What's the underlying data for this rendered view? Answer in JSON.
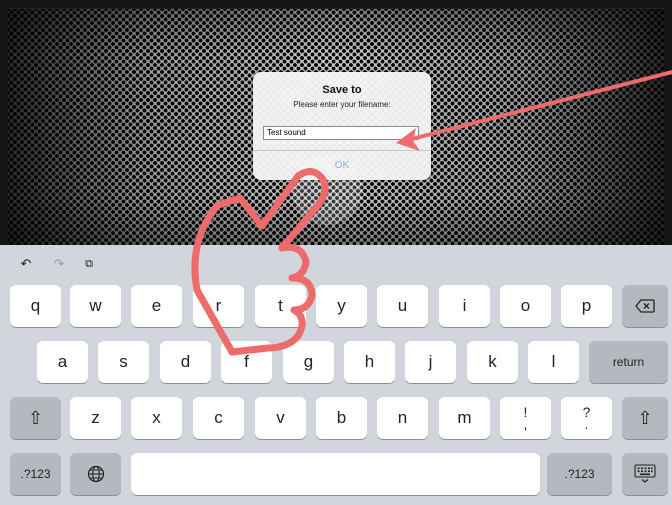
{
  "dialog": {
    "title": "Save to",
    "message": "Please enter your filename:",
    "input_value": "Test sound",
    "ok_label": "OK"
  },
  "keyboard": {
    "toolbar": {
      "undo_icon": "undo-icon",
      "redo_icon": "redo-icon",
      "paste_icon": "paste-icon"
    },
    "row1": [
      "q",
      "w",
      "e",
      "r",
      "t",
      "y",
      "u",
      "i",
      "o",
      "p"
    ],
    "row2": [
      "a",
      "s",
      "d",
      "f",
      "g",
      "h",
      "j",
      "k",
      "l"
    ],
    "row3": [
      "z",
      "x",
      "c",
      "v",
      "b",
      "n",
      "m"
    ],
    "punct1": {
      "top": "!",
      "bottom": ","
    },
    "punct2": {
      "top": "?",
      "bottom": "."
    },
    "return_label": "return",
    "numbers_label_left": ".?123",
    "numbers_label_right": ".?123"
  },
  "colors": {
    "annotation": "#ee6b6b",
    "ok_blue": "#5aa0ff",
    "keyboard_bg": "#d2d5db"
  }
}
